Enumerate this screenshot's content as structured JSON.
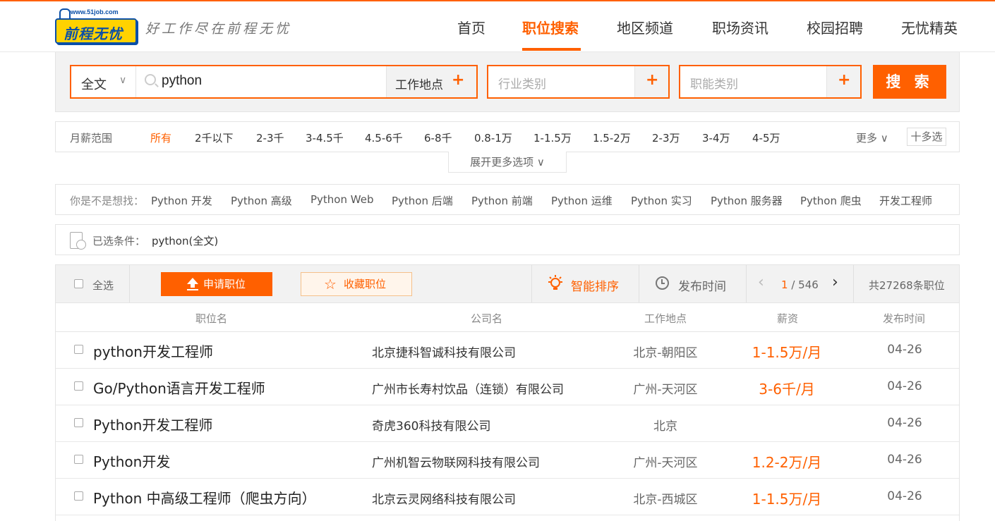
{
  "brand": {
    "url": "www.51job.com",
    "name": "前程无忧",
    "slogan": "好工作尽在前程无忧",
    "orange": "#ff6000",
    "blue": "#0a4fa8",
    "yellow": "#ffd200"
  },
  "nav": {
    "items": [
      "首页",
      "职位搜索",
      "地区频道",
      "职场资讯",
      "校园招聘",
      "无忧精英"
    ],
    "active_index": 1
  },
  "search": {
    "scope": "全文",
    "keyword": "python",
    "location_label": "工作地点",
    "industry_placeholder": "行业类别",
    "function_placeholder": "职能类别",
    "plus": "+",
    "button": "搜 索"
  },
  "salary_filter": {
    "label": "月薪范围",
    "options": [
      "所有",
      "2千以下",
      "2-3千",
      "3-4.5千",
      "4.5-6千",
      "6-8千",
      "0.8-1万",
      "1-1.5万",
      "1.5-2万",
      "2-3万",
      "3-4万",
      "4-5万"
    ],
    "active_index": 0,
    "more": "更多",
    "multi": "十多选",
    "expand": "展开更多选项"
  },
  "suggestions": {
    "label": "你是不是想找：",
    "items": [
      "Python 开发",
      "Python 高级",
      "Python Web",
      "Python 后端",
      "Python 前端",
      "Python 运维",
      "Python 实习",
      "Python 服务器",
      "Python 爬虫",
      "开发工程师"
    ]
  },
  "chosen": {
    "label": "已选条件：",
    "value": "python(全文)"
  },
  "toolbar": {
    "select_all": "全选",
    "apply": "申请职位",
    "favorite": "收藏职位",
    "smart_sort": "智能排序",
    "publish_time": "发布时间",
    "page_current": "1",
    "page_total": "/ 546",
    "total": "共27268条职位"
  },
  "table": {
    "headers": [
      "职位名",
      "公司名",
      "工作地点",
      "薪资",
      "发布时间"
    ],
    "rows": [
      {
        "title": "python开发工程师",
        "company": "北京捷科智诚科技有限公司",
        "location": "北京-朝阳区",
        "salary": "1-1.5万/月",
        "date": "04-26"
      },
      {
        "title": "Go/Python语言开发工程师",
        "company": "广州市长寿村饮品（连锁）有限公司",
        "location": "广州-天河区",
        "salary": "3-6千/月",
        "date": "04-26"
      },
      {
        "title": "Python开发工程师",
        "company": "奇虎360科技有限公司",
        "location": "北京",
        "salary": "",
        "date": "04-26"
      },
      {
        "title": "Python开发",
        "company": "广州机智云物联网科技有限公司",
        "location": "广州-天河区",
        "salary": "1.2-2万/月",
        "date": "04-26"
      },
      {
        "title": "Python 中高级工程师（爬虫方向）",
        "company": "北京云灵网络科技有限公司",
        "location": "北京-西城区",
        "salary": "1-1.5万/月",
        "date": "04-26"
      }
    ]
  }
}
